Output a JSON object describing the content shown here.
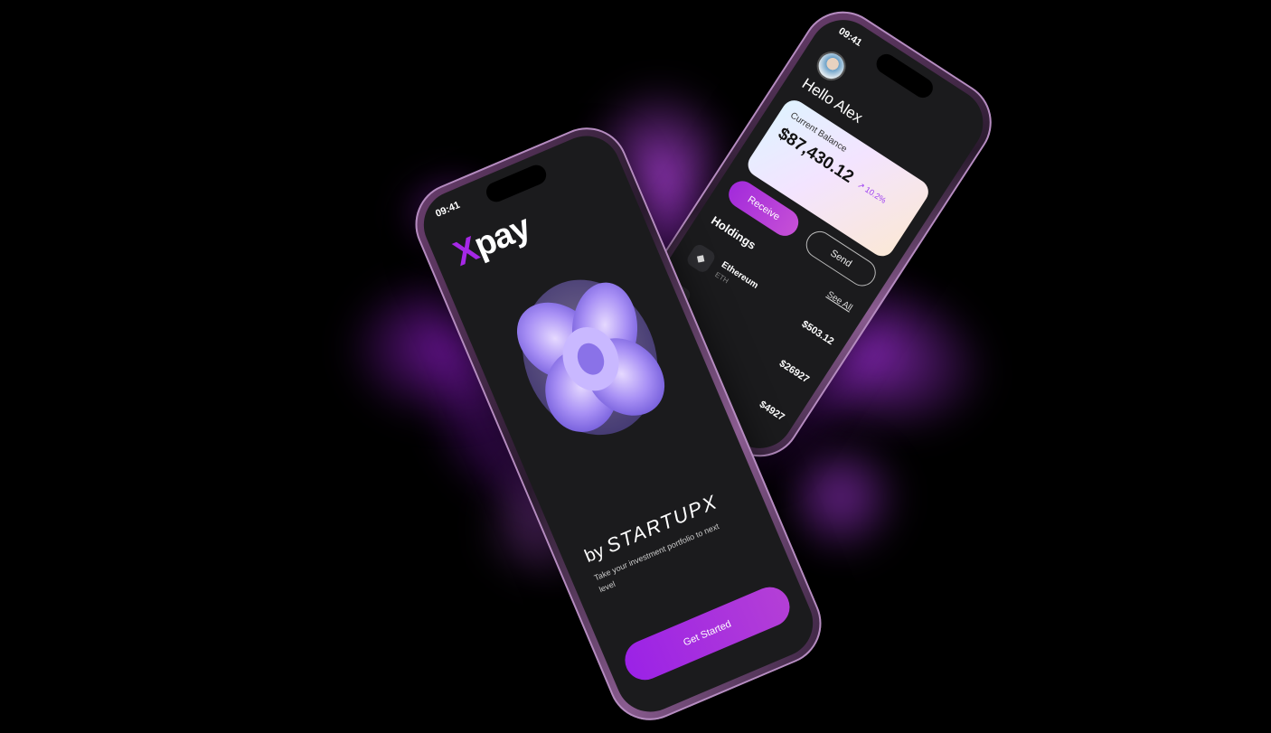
{
  "front_phone": {
    "time": "09:41",
    "logo_x": "X",
    "logo_rest": "pay",
    "by_prefix": "by",
    "brand": "STARTUPX",
    "tagline": "Take your investment portfolio to next level",
    "cta_label": "Get Started"
  },
  "back_phone": {
    "time": "09:41",
    "greeting": "Hello Alex",
    "balance_label": "Current Balance",
    "balance_value": "$87,430.12",
    "balance_change": "↗ 10.2%",
    "receive_label": "Receive",
    "send_label": "Send",
    "holdings_title": "Holdings",
    "see_all_label": "See All",
    "holdings": [
      {
        "name": "Ethereum",
        "symbol": "ETH",
        "value": "$503.12",
        "icon": "ethereum-icon"
      },
      {
        "name": "",
        "symbol": "",
        "value": "$26927",
        "icon": "coin-icon"
      },
      {
        "name": "",
        "symbol": "",
        "value": "$4927",
        "icon": "coin-icon"
      }
    ]
  },
  "colors": {
    "accent": "#a628e6",
    "background": "#000000",
    "splash": "#a030d8"
  }
}
